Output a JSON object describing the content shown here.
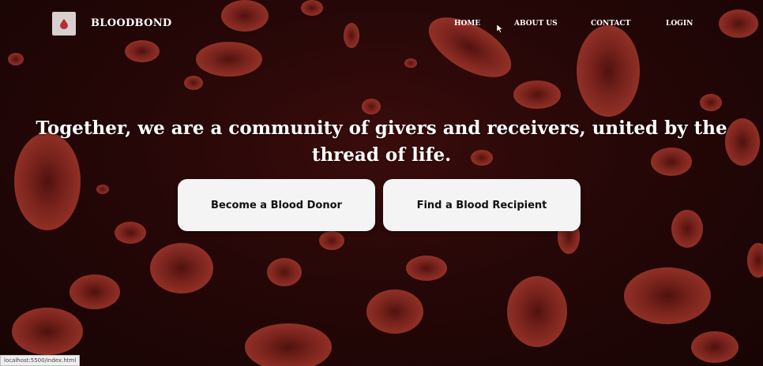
{
  "brand": {
    "name": "BLOODBOND",
    "logo_icon": "blood-drop-icon"
  },
  "nav": {
    "items": [
      {
        "label": "HOME"
      },
      {
        "label": "ABOUT US"
      },
      {
        "label": "CONTACT"
      },
      {
        "label": "LOGIN"
      }
    ]
  },
  "hero": {
    "title": "Together, we are a community of givers and receivers, united by the thread of life.",
    "primary_button": "Become a Blood Donor",
    "secondary_button": "Find a Blood Recipient"
  },
  "status_bar": {
    "url": "localhost:5500/index.html"
  },
  "colors": {
    "background": "#260707",
    "cell": "#8a2a22",
    "button_bg": "#f4f4f4",
    "text_light": "#ffffff"
  }
}
